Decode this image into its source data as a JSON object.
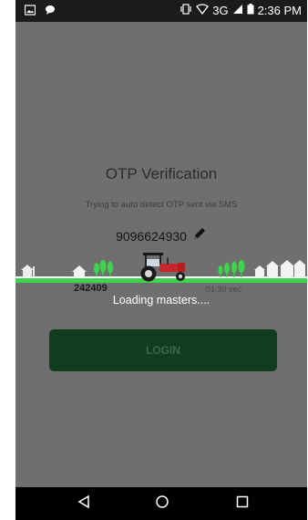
{
  "status_bar": {
    "network": "3G",
    "time": "2:36 PM"
  },
  "otp": {
    "title": "OTP Verification",
    "subtitle": "Trying to auto detect OTP sent via SMS",
    "phone_number": "9096624930",
    "otp_value": "242409",
    "timer": "01:30 sec"
  },
  "loading": {
    "text": "Loading masters...."
  },
  "login_button": {
    "label": "LOGIN"
  },
  "colors": {
    "overlay": "#6f6f6f",
    "progress_green": "#3dd34a",
    "login_bg": "#123c1f"
  },
  "icons": {
    "status_left": [
      "image-icon",
      "message-icon"
    ],
    "status_right": [
      "vibrate-icon",
      "wifi-icon",
      "signal-icon",
      "battery-icon"
    ],
    "phone_edit": "pencil-icon",
    "nav": [
      "back-icon",
      "home-icon",
      "recents-icon"
    ]
  }
}
